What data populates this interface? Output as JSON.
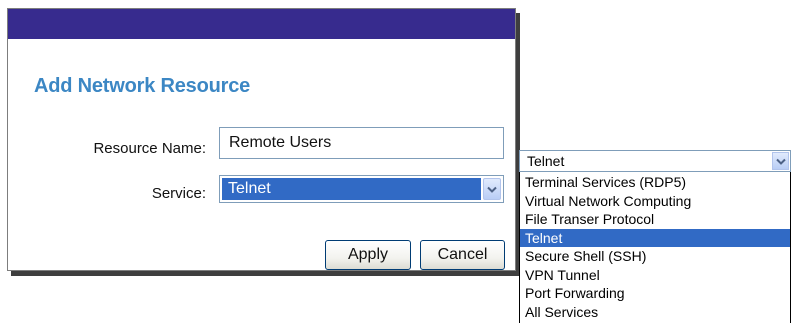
{
  "dialog": {
    "title": "Add Network Resource",
    "resource_name_label": "Resource Name:",
    "resource_name_value": "Remote Users",
    "service_label": "Service:",
    "service_value": "Telnet",
    "apply_label": "Apply",
    "cancel_label": "Cancel",
    "header_bar_color": "#372b8e",
    "title_color": "#3c87c4",
    "selection_color": "#316ac5"
  },
  "dropdown": {
    "selected_value": "Telnet",
    "arrow_icon": "chevron-down-icon",
    "options": [
      "Terminal Services (RDP5)",
      "Virtual Network Computing",
      "File Transer Protocol",
      "Telnet",
      "Secure Shell (SSH)",
      "VPN Tunnel",
      "Port Forwarding",
      "All Services"
    ],
    "highlighted_index": 3
  }
}
